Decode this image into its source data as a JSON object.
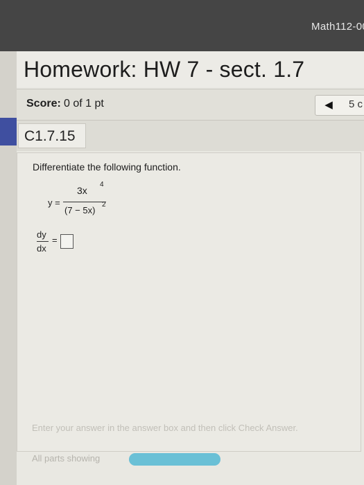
{
  "course": {
    "name": "Math112-00"
  },
  "homework": {
    "title": "Homework: HW 7 - sect. 1.7"
  },
  "score": {
    "label": "Score:",
    "value": "0 of 1 pt"
  },
  "pager": {
    "prev_icon": "left-triangle-icon",
    "prev_glyph": "◀",
    "page_partial": "5 c"
  },
  "question": {
    "id": "C1.7.15",
    "prompt": "Differentiate the following function.",
    "y_label": "y =",
    "numerator": "3x",
    "numerator_exp": "4",
    "denominator": "(7 − 5x)",
    "denominator_exp": "2",
    "dy": "dy",
    "dx": "dx",
    "equals": "="
  },
  "instructions": "Enter your answer in the answer box and then click Check Answer.",
  "parts": {
    "label": "All parts showing",
    "progress": 1.0
  },
  "colors": {
    "topbar": "#454545",
    "accent": "#3f4fa0",
    "progress": "#6ac0d6"
  }
}
